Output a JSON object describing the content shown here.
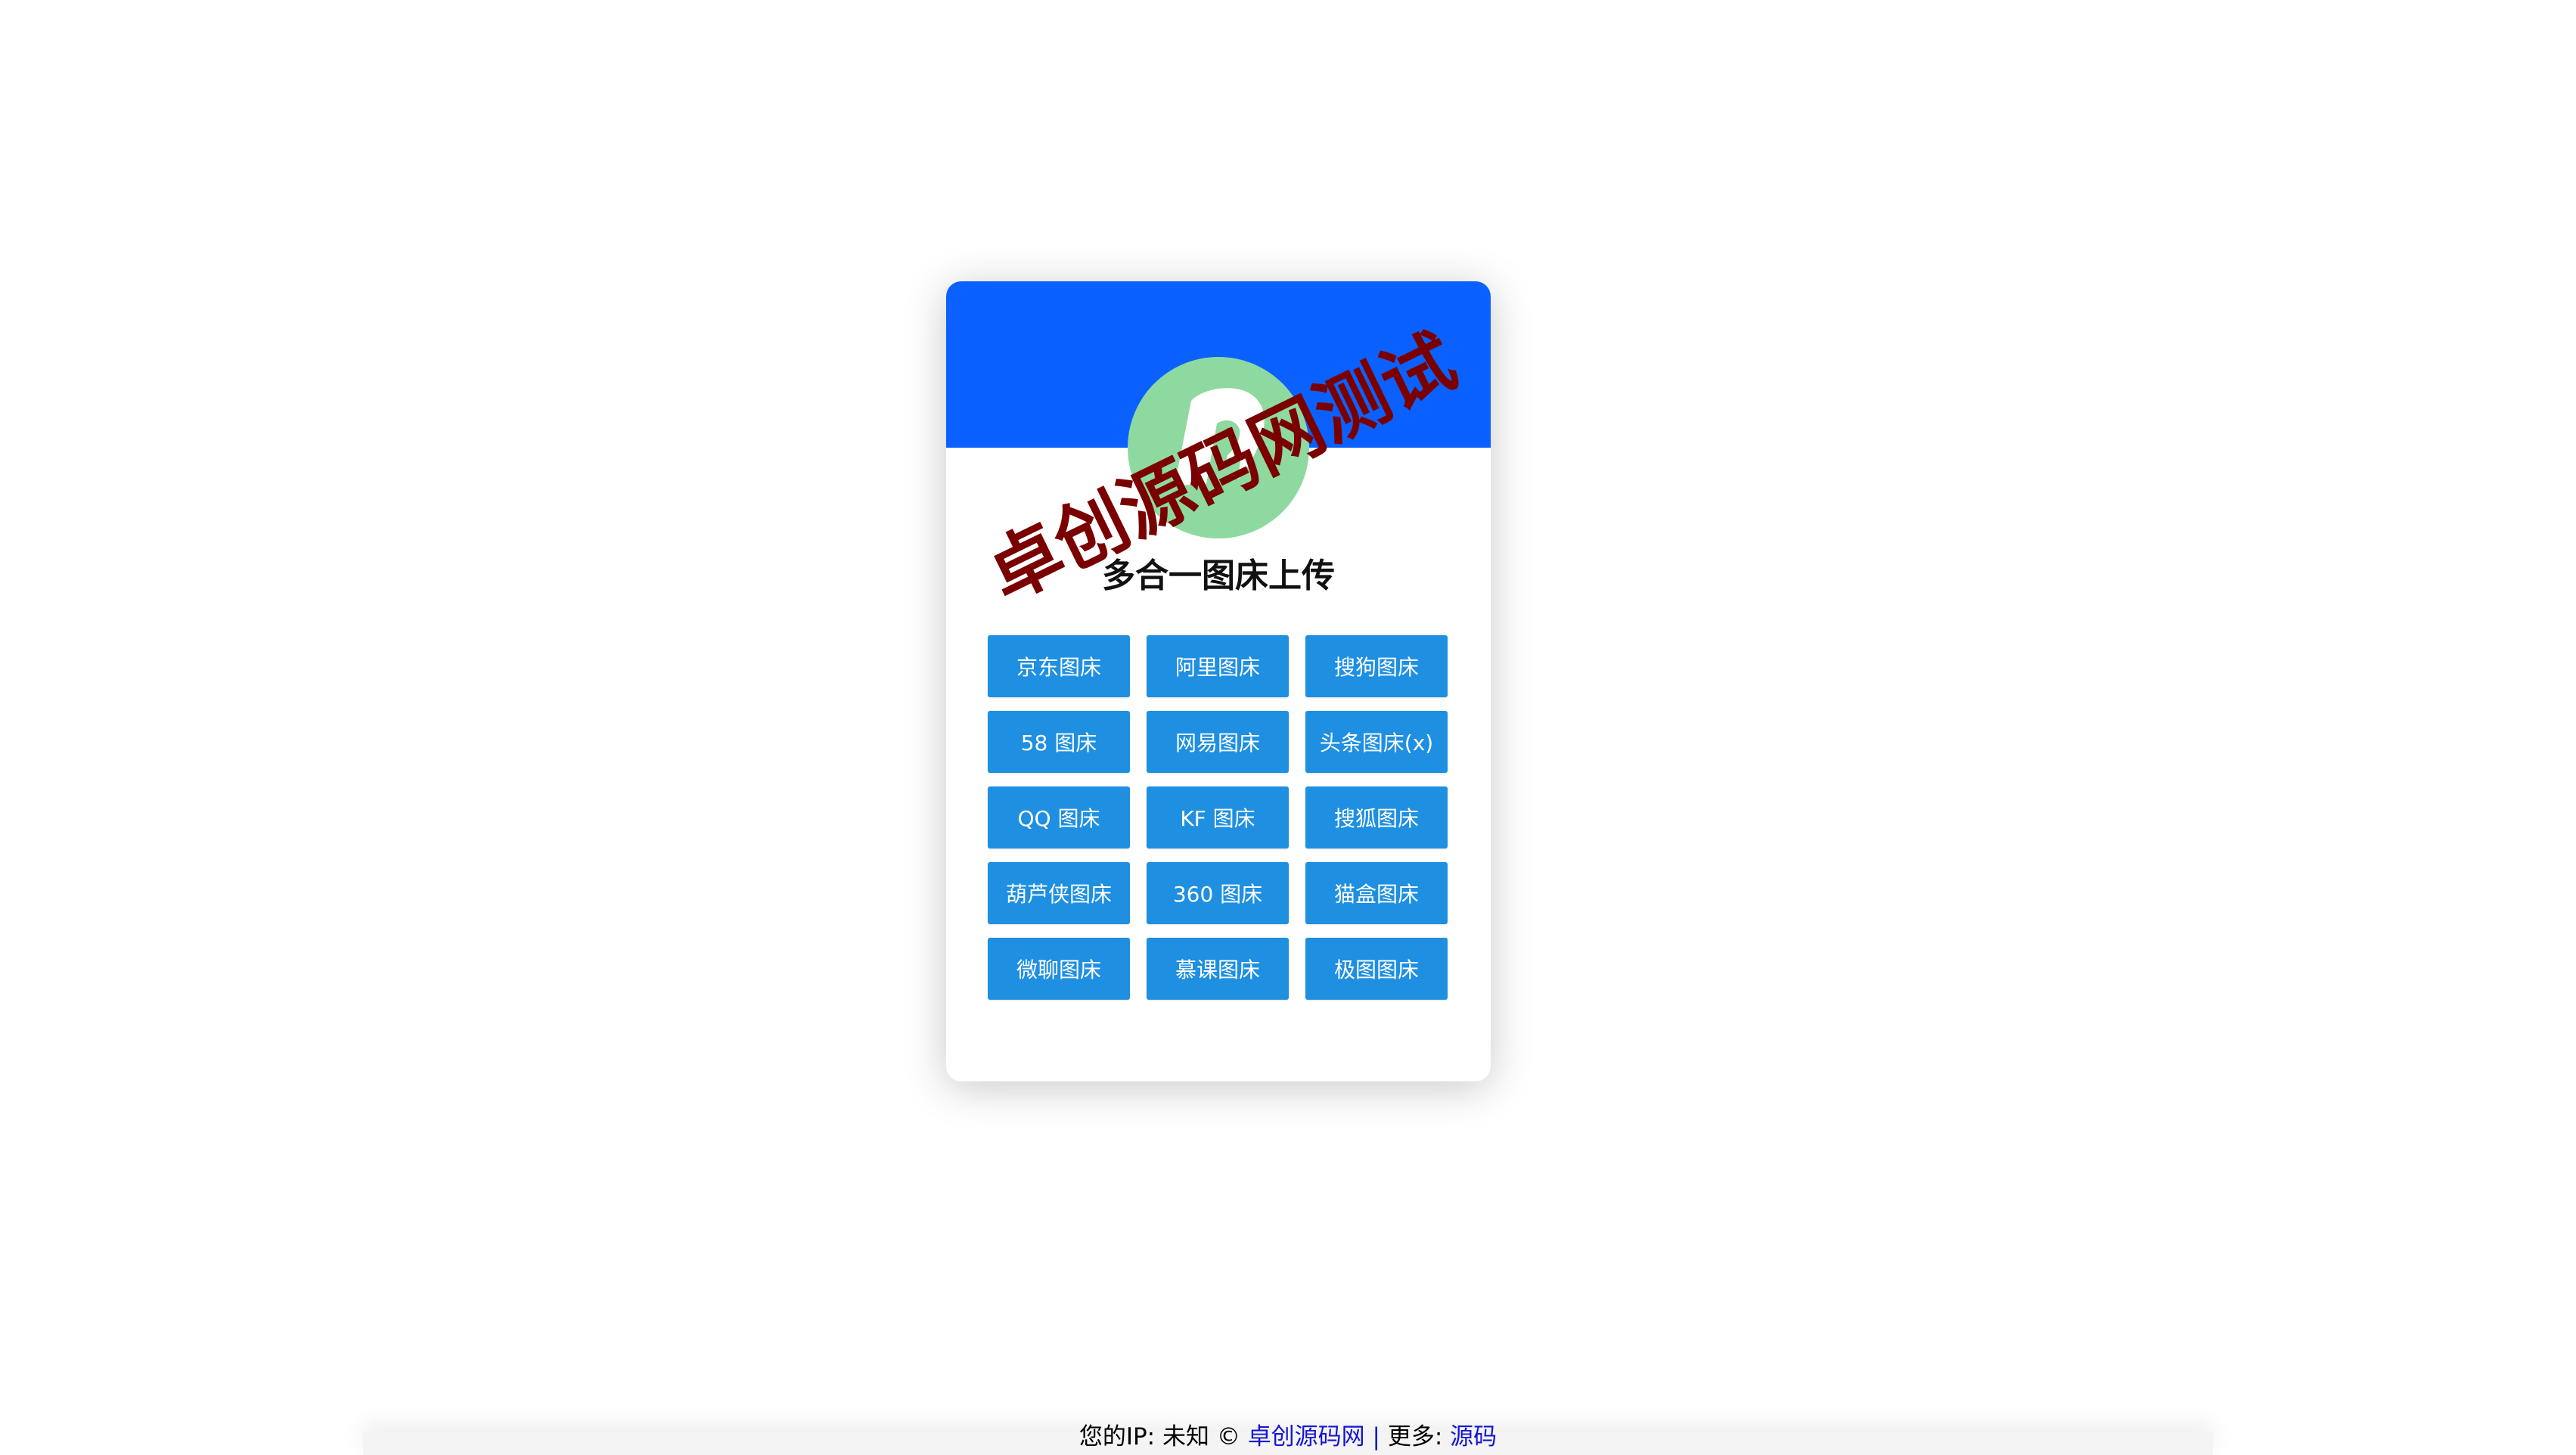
{
  "card": {
    "title": "多合一图床上传"
  },
  "buttons": [
    "京东图床",
    "阿里图床",
    "搜狗图床",
    "58 图床",
    "网易图床",
    "头条图床(x)",
    "QQ 图床",
    "KF 图床",
    "搜狐图床",
    "葫芦侠图床",
    "360 图床",
    "猫盒图床",
    "微聊图床",
    "慕课图床",
    "极图图床"
  ],
  "watermark": "卓创源码网测试",
  "footer": {
    "ip_label": "您的IP: 未知 © ",
    "site_link": "卓创源码网",
    "separator": " | ",
    "more_label": "更多: ",
    "more_link": "源码"
  },
  "colors": {
    "header": "#0a61ff",
    "button": "#1e8fe1",
    "logo_bg": "#8ed9a0",
    "watermark": "#7a0000",
    "link": "#1414d2"
  }
}
